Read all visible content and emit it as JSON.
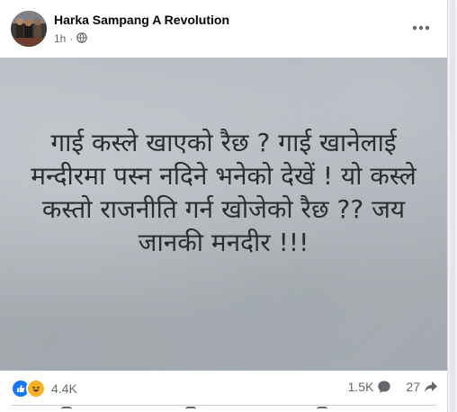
{
  "post": {
    "author": "Harka Sampang A Revolution",
    "time": "1h",
    "separator": "·",
    "privacy_icon": "globe-icon",
    "more_icon": "more-horizontal-icon",
    "image_text": "गाई कस्ले खाएको रैछ ? गाई खानेलाई मन्दीरमा पस्न नदिने भनेको देखें ! यो कस्ले कस्तो राजनीति गर्न खोजेको रैछ ?? जय जानकी मनदीर !!!"
  },
  "stats": {
    "reaction_icons": [
      "like-icon",
      "haha-icon"
    ],
    "reaction_count": "4.4K",
    "comments_count": "1.5K",
    "shares_count": "27"
  },
  "colors": {
    "brand_blue": "#1877f2",
    "haha_yellow": "#f7b125",
    "text_primary": "#050505",
    "text_secondary": "#65676b"
  }
}
